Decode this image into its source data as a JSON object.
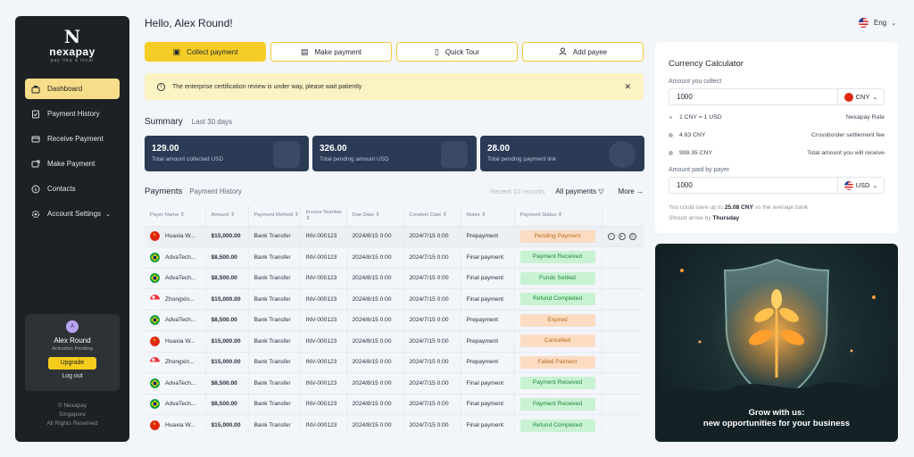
{
  "brand": {
    "logo_letter": "N",
    "name": "nexapay",
    "tagline": "pay like a local"
  },
  "sidebar": {
    "items": [
      {
        "label": "Dashboard",
        "icon": "dashboard-icon"
      },
      {
        "label": "Payment History",
        "icon": "history-icon"
      },
      {
        "label": "Receive Payment",
        "icon": "receive-icon"
      },
      {
        "label": "Make Payment",
        "icon": "send-icon"
      },
      {
        "label": "Contacts",
        "icon": "contacts-icon"
      },
      {
        "label": "Account Settings",
        "icon": "gear-icon"
      }
    ],
    "user": {
      "avatar_letter": "A",
      "name": "Alex Round",
      "status": "Activation Pending",
      "upgrade_label": "Upgrade",
      "logout_label": "Log out"
    },
    "copyright": [
      "© Nexapay",
      "Singapore",
      "All Rights Reserved"
    ]
  },
  "header": {
    "greeting": "Hello,  Alex Round!",
    "language": "Eng"
  },
  "actions": [
    {
      "label": "Collect payment",
      "icon": "wallet-icon"
    },
    {
      "label": "Make payment",
      "icon": "send-money-icon"
    },
    {
      "label": "Quick Tour",
      "icon": "book-icon"
    },
    {
      "label": "Add payee",
      "icon": "user-icon"
    }
  ],
  "notice": {
    "text": "The enterprise certification review is under way, please wait patiently"
  },
  "summary": {
    "title": "Summary",
    "period": "Last 30 days",
    "cards": [
      {
        "value": "129.00",
        "label": "Total amount collected USD"
      },
      {
        "value": "326.00",
        "label": "Total pending amount USD"
      },
      {
        "value": "28.00",
        "label": "Total pending payment link"
      }
    ]
  },
  "payments": {
    "title": "Payments",
    "history_link": "Payment History",
    "recent": "Recent 10 records",
    "filter": "All payments",
    "more": "More",
    "columns": [
      "Payer Name",
      "Amount",
      "Payment Method",
      "Invoice Number",
      "Due Date",
      "Creation Date",
      "Notes",
      "Payment Status"
    ],
    "rows": [
      {
        "flag": "cn",
        "payer": "Huaxia W...",
        "amount": "$15,000.00",
        "method": "Bank Transfer",
        "invoice": "INV-000123",
        "due": "2024/8/15 0:00",
        "created": "2024/7/15 0:00",
        "notes": "Prepayment",
        "status": "Pending Payment",
        "kind": "pending"
      },
      {
        "flag": "br",
        "payer": "AdvaTech...",
        "amount": "$8,500.00",
        "method": "Bank Transfer",
        "invoice": "INV-000123",
        "due": "2024/8/15 0:00",
        "created": "2024/7/15 0:00",
        "notes": "Final payment",
        "status": "Payment Received",
        "kind": "received"
      },
      {
        "flag": "br",
        "payer": "AdvaTech...",
        "amount": "$8,500.00",
        "method": "Bank Transfer",
        "invoice": "INV-000123",
        "due": "2024/8/15 0:00",
        "created": "2024/7/15 0:00",
        "notes": "Final payment",
        "status": "Funds Settled",
        "kind": "received"
      },
      {
        "flag": "sg",
        "payer": "Zhongxin...",
        "amount": "$15,000.00",
        "method": "Bank Transfer",
        "invoice": "INV-000123",
        "due": "2024/8/15 0:00",
        "created": "2024/7/15 0:00",
        "notes": "Final payment",
        "status": "Refund Completed",
        "kind": "received"
      },
      {
        "flag": "br",
        "payer": "AdvaTech...",
        "amount": "$8,500.00",
        "method": "Bank Transfer",
        "invoice": "INV-000123",
        "due": "2024/8/15 0:00",
        "created": "2024/7/15 0:00",
        "notes": "Prepayment",
        "status": "Expired",
        "kind": "pending"
      },
      {
        "flag": "cn",
        "payer": "Huaxia W...",
        "amount": "$15,000.00",
        "method": "Bank Transfer",
        "invoice": "INV-000123",
        "due": "2024/8/15 0:00",
        "created": "2024/7/15 0:00",
        "notes": "Prepayment",
        "status": "Cancelled",
        "kind": "pending"
      },
      {
        "flag": "sg",
        "payer": "Zhongxin...",
        "amount": "$15,000.00",
        "method": "Bank Transfer",
        "invoice": "INV-000123",
        "due": "2024/8/15 0:00",
        "created": "2024/7/15 0:00",
        "notes": "Prepayment",
        "status": "Failed Paiment",
        "kind": "pending"
      },
      {
        "flag": "br",
        "payer": "AdvaTech...",
        "amount": "$8,500.00",
        "method": "Bank Transfer",
        "invoice": "INV-000123",
        "due": "2024/8/15 0:00",
        "created": "2024/7/15 0:00",
        "notes": "Final payment",
        "status": "Payment Received",
        "kind": "received"
      },
      {
        "flag": "br",
        "payer": "AdvaTech...",
        "amount": "$8,500.00",
        "method": "Bank Transfer",
        "invoice": "INV-000123",
        "due": "2024/8/15 0:00",
        "created": "2024/7/15 0:00",
        "notes": "Final payment",
        "status": "Payment Received",
        "kind": "received"
      },
      {
        "flag": "cn",
        "payer": "Huaxia W...",
        "amount": "$15,000.00",
        "method": "Bank Transfer",
        "invoice": "INV-000123",
        "due": "2024/8/15 0:00",
        "created": "2024/7/15 0:00",
        "notes": "Final payment",
        "status": "Refund Completed",
        "kind": "received"
      }
    ]
  },
  "calculator": {
    "title": "Currency Calculator",
    "collect_label": "Amount you collect",
    "collect_value": "1000",
    "collect_currency": "CNY",
    "rate_text": "1 CNY = 1 USD",
    "rate_label": "Nexapay Rate",
    "fee_text": "4.83 CNY",
    "fee_label": "Crossborder settlement fee",
    "receive_text": "998.35 CNY",
    "receive_label": "Total amount you will receive",
    "paid_label": "Amount paid by payer",
    "paid_value": "1000",
    "paid_currency": "USD",
    "save_pre": "You could save up to",
    "save_amount": "25.08 CNY",
    "save_post": "vs the average bank",
    "arrive_pre": "Should arrive by",
    "arrive_day": "Thursday"
  },
  "banner": {
    "line1": "Grow with us:",
    "line2": "new opportunities for your business"
  },
  "colors": {
    "accent": "#f6cd26",
    "sidebar": "#1d2125",
    "card": "#2b3a55"
  }
}
